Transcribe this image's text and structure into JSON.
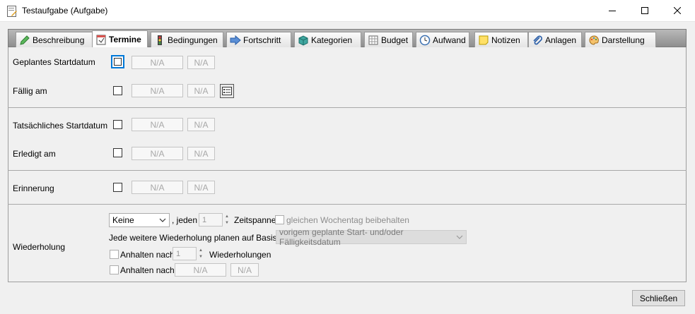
{
  "window": {
    "title": "Testaufgabe (Aufgabe)"
  },
  "tabs": [
    {
      "label": "Beschreibung",
      "icon": "pencil-icon",
      "active": false
    },
    {
      "label": "Termine",
      "icon": "calendar-icon",
      "active": true
    },
    {
      "label": "Bedingungen",
      "icon": "traffic-light-icon",
      "active": false
    },
    {
      "label": "Fortschritt",
      "icon": "arrow-right-icon",
      "active": false
    },
    {
      "label": "Kategorien",
      "icon": "cube-icon",
      "active": false
    },
    {
      "label": "Budget",
      "icon": "spreadsheet-icon",
      "active": false
    },
    {
      "label": "Aufwand",
      "icon": "clock-icon",
      "active": false
    },
    {
      "label": "Notizen",
      "icon": "note-icon",
      "active": false
    },
    {
      "label": "Anlagen",
      "icon": "paperclip-icon",
      "active": false
    },
    {
      "label": "Darstellung",
      "icon": "palette-icon",
      "active": false
    }
  ],
  "dates": {
    "planned_start": {
      "label": "Geplantes Startdatum",
      "date": "N/A",
      "time": "N/A"
    },
    "due": {
      "label": "Fällig am",
      "date": "N/A",
      "time": "N/A"
    },
    "actual_start": {
      "label": "Tatsächliches Startdatum",
      "date": "N/A",
      "time": "N/A"
    },
    "done": {
      "label": "Erledigt am",
      "date": "N/A",
      "time": "N/A"
    },
    "reminder": {
      "label": "Erinnerung",
      "date": "N/A",
      "time": "N/A"
    }
  },
  "recurrence": {
    "label": "Wiederholung",
    "frequency": "Keine",
    "every_label": ", jeden",
    "every_value": "1",
    "unit_label": "Zeitspanne",
    "same_weekday_label": "gleichen Wochentag beibehalten",
    "basis_label": "Jede weitere Wiederholung planen auf Basis von",
    "basis_value": "vorigem geplante Start- und/oder Fälligkeitsdatum",
    "stop_after_label": "Anhalten nach",
    "stop_after_value": "1",
    "stop_after_unit": "Wiederholungen",
    "stop_on_label": "Anhalten nach",
    "stop_on_date": "N/A",
    "stop_on_time": "N/A"
  },
  "buttons": {
    "close": "Schließen"
  }
}
